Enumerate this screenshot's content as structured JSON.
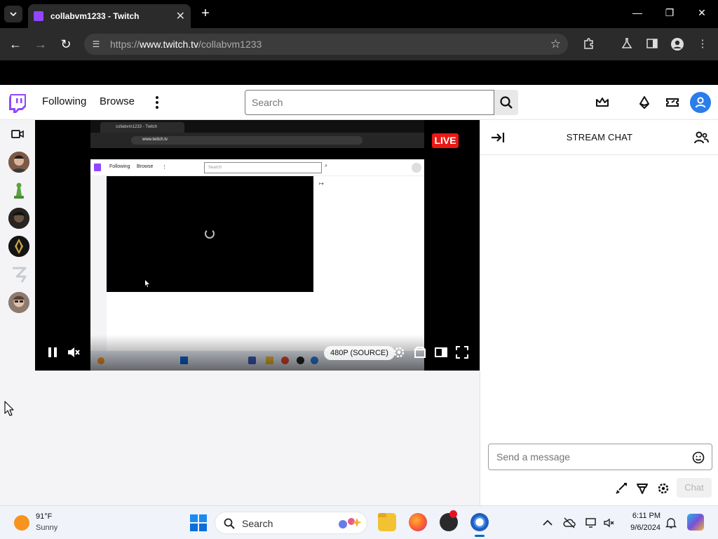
{
  "browser": {
    "tab_title": "collabvm1233 - Twitch",
    "url_prefix": "https://",
    "url_host": "www.twitch.tv",
    "url_path": "/collabvm1233"
  },
  "twitch_nav": {
    "following": "Following",
    "browse": "Browse",
    "search_placeholder": "Search"
  },
  "player": {
    "live_label": "LIVE",
    "quality": "480P (SOURCE)",
    "stream_content": {
      "tab_title": "collabvm1233 - Twitch",
      "url": "https://www.twitch.tv/collabvm1233",
      "url_host": "www.twitch.tv",
      "following": "Following",
      "browse": "Browse",
      "search_placeholder": "Search"
    }
  },
  "chat": {
    "title": "STREAM CHAT",
    "input_placeholder": "Send a message",
    "send_label": "Chat"
  },
  "taskbar": {
    "weather_temp": "91°F",
    "weather_desc": "Sunny",
    "search_label": "Search",
    "time": "6:11 PM",
    "date": "9/6/2024"
  },
  "colors": {
    "twitch_purple": "#9146ff",
    "live_red": "#e91916",
    "user_blue": "#2b7de9"
  }
}
